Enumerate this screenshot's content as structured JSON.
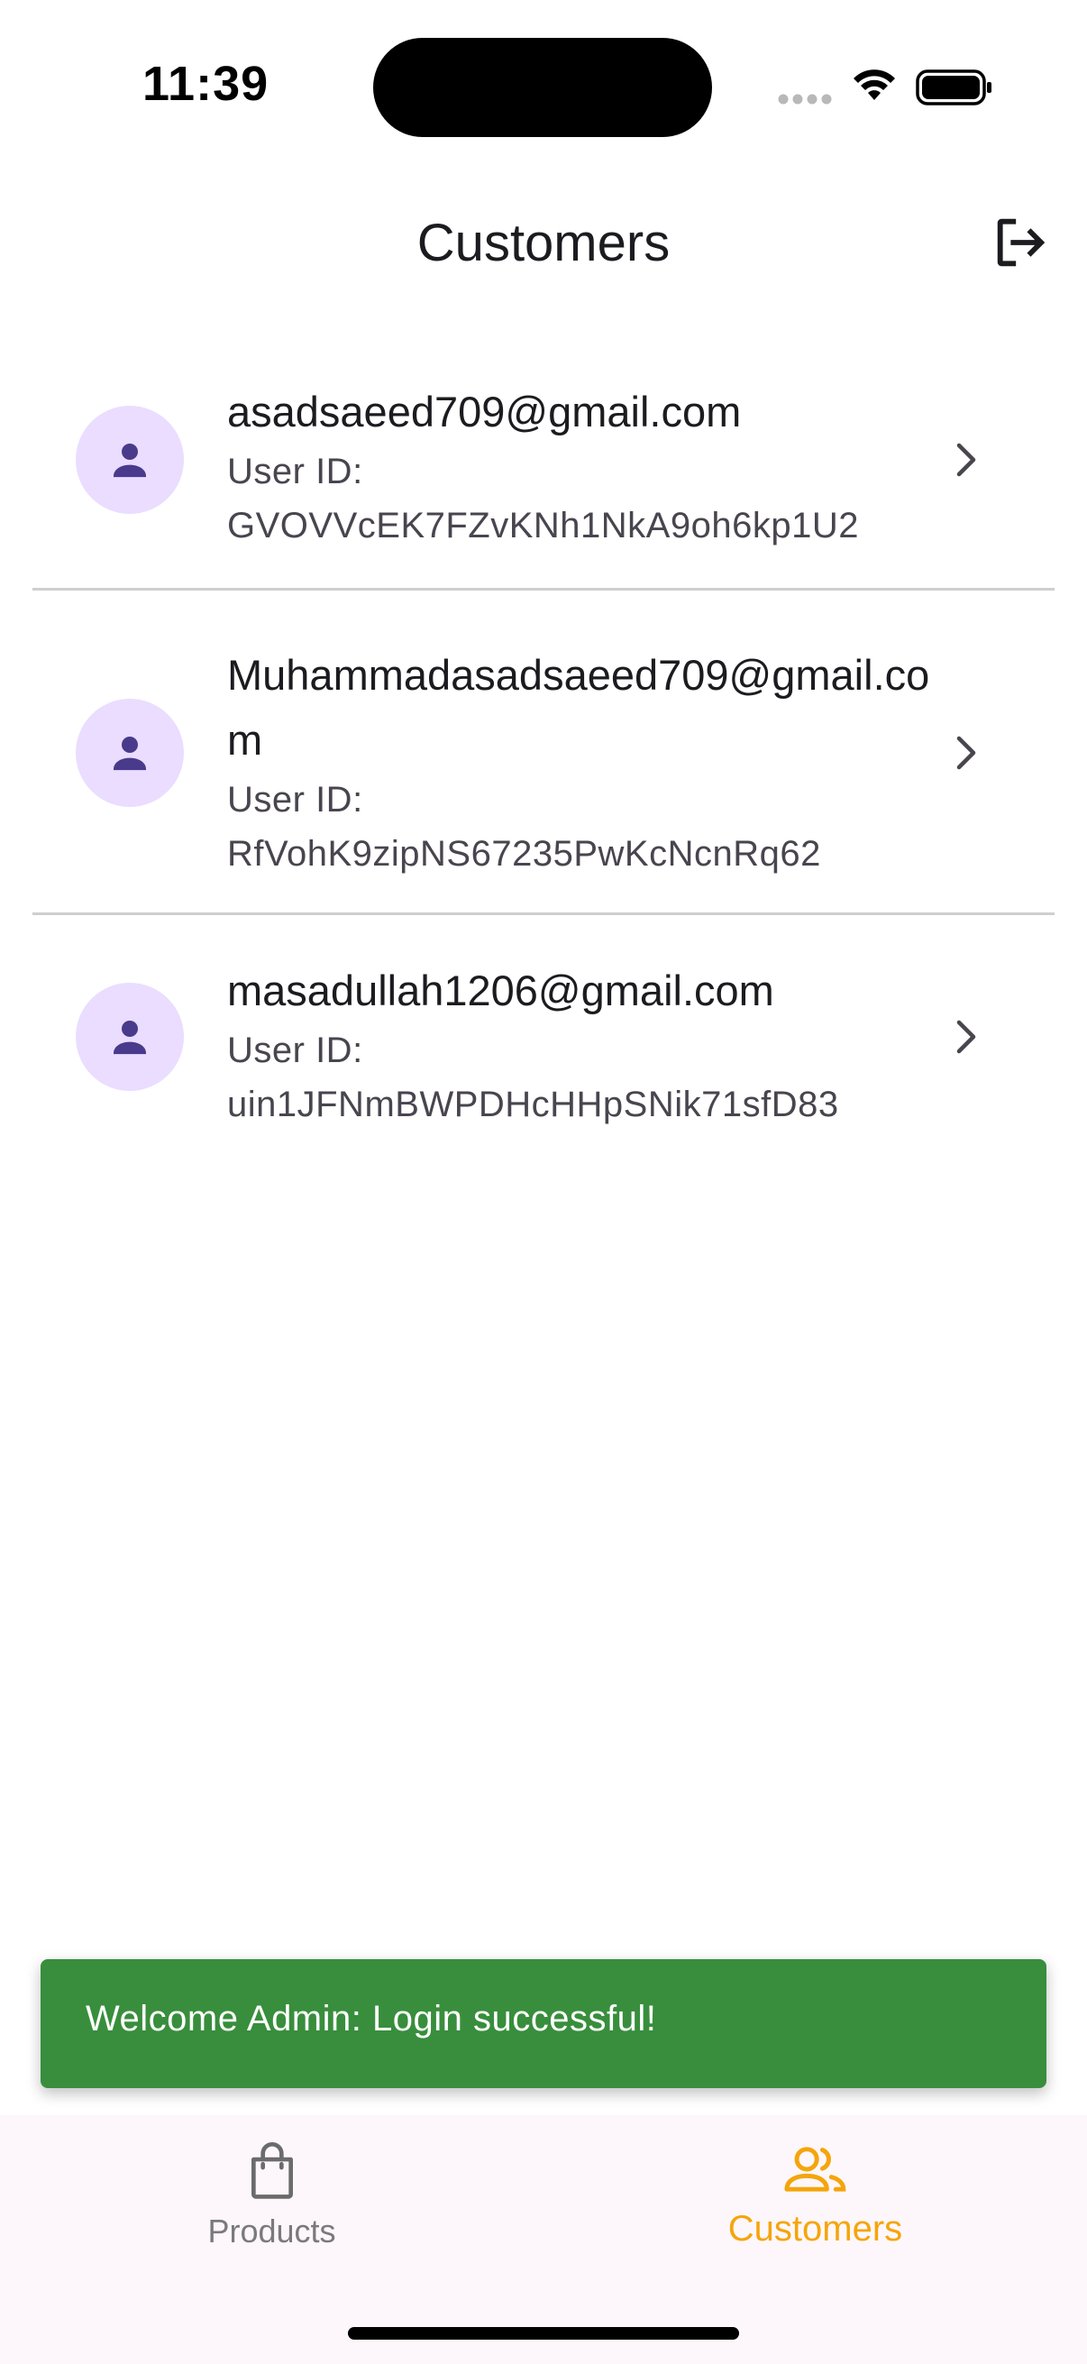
{
  "status_bar": {
    "time": "11:39"
  },
  "app_bar": {
    "title": "Customers"
  },
  "customers": [
    {
      "email": "asadsaeed709@gmail.com",
      "uid_label": "User ID:",
      "uid": "GVOVVcEK7FZvKNh1NkA9oh6kp1U2"
    },
    {
      "email": "Muhammadasadsaeed709@gmail.com",
      "uid_label": "User ID:",
      "uid": "RfVohK9zipNS67235PwKcNcnRq62"
    },
    {
      "email": "masadullah1206@gmail.com",
      "uid_label": "User ID:",
      "uid": "uin1JFNmBWPDHcHHpSNik71sfD83"
    }
  ],
  "snackbar": {
    "message": "Welcome Admin: Login successful!",
    "color": "#388e3c"
  },
  "bottom_nav": {
    "items": [
      {
        "label": "Products",
        "icon": "shopping-bag-icon",
        "selected": false
      },
      {
        "label": "Customers",
        "icon": "people-icon",
        "selected": true
      }
    ],
    "active_color": "#f5a50b"
  },
  "colors": {
    "avatar_bg": "#eaddff",
    "avatar_fg": "#4a3a8c",
    "divider": "#cfcfcf"
  }
}
